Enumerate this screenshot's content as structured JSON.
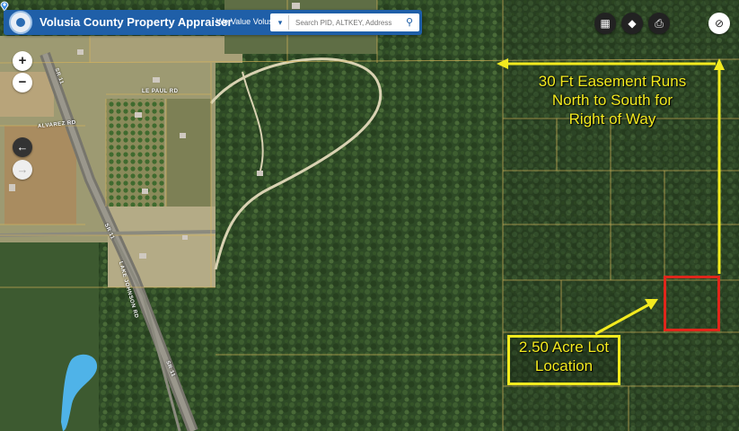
{
  "header": {
    "title": "Volusia County Property Appraiser",
    "slogan": "We Value Volusia!",
    "search_placeholder": "Search PID, ALTKEY, Address",
    "brand_color": "#1f5fa8"
  },
  "controls": {
    "zoom_in": "+",
    "zoom_out": "−",
    "back": "←",
    "forward": "→"
  },
  "toolbar": {
    "icons": [
      "grid-icon",
      "basemap-icon",
      "print-icon",
      "visibility-icon"
    ]
  },
  "roads": {
    "le_paul": "LE PAUL RD",
    "alvarez": "ALVAREZ RD",
    "hwy_main_1": "SR 11",
    "hwy_main_2": "SR 11",
    "hwy_main_3": "SR 11",
    "side_road": "LAKE JOHNSON RD"
  },
  "annotations": {
    "easement": [
      "30 Ft Easement Runs",
      "North to South for",
      "Right of Way"
    ],
    "lot": [
      "2.50 Acre Lot",
      "Location"
    ],
    "annotation_color": "#f2ea1f",
    "lot_outline_color": "#e0261b"
  }
}
